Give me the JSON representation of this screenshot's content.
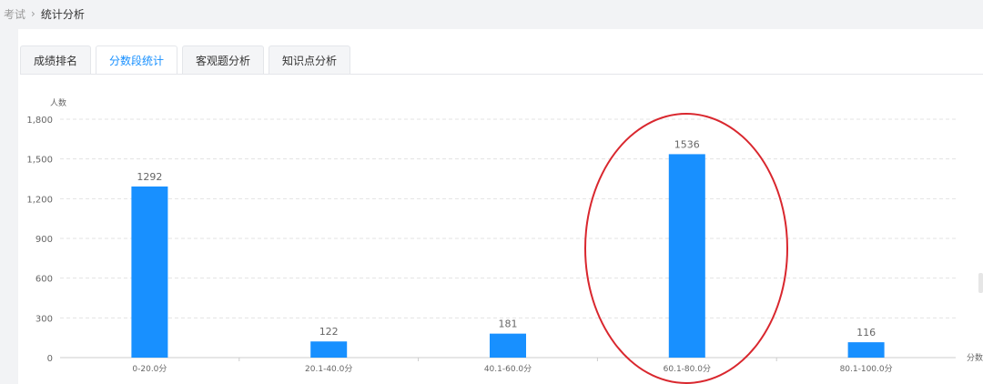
{
  "breadcrumb": {
    "parent": "考试",
    "separator": "›",
    "current": "统计分析"
  },
  "tabs": [
    {
      "label": "成绩排名",
      "active": false
    },
    {
      "label": "分数段统计",
      "active": true
    },
    {
      "label": "客观题分析",
      "active": false
    },
    {
      "label": "知识点分析",
      "active": false
    }
  ],
  "colors": {
    "bar": "#1890ff",
    "active_tab": "#1890ff",
    "circle": "#d9272e"
  },
  "chart_data": {
    "type": "bar",
    "categories": [
      "0-20.0分",
      "20.1-40.0分",
      "40.1-60.0分",
      "60.1-80.0分",
      "80.1-100.0分"
    ],
    "values": [
      1292,
      122,
      181,
      1536,
      116
    ],
    "data_labels": [
      "1292",
      "122",
      "181",
      "1536",
      "116"
    ],
    "ylabel": "人数",
    "xlabel": "分数",
    "ylim": [
      0,
      1800
    ],
    "yticks": [
      0,
      300,
      600,
      900,
      1200,
      1500,
      1800
    ],
    "ytick_labels": [
      "0",
      "300",
      "600",
      "900",
      "1,200",
      "1,500",
      "1,800"
    ],
    "grid": true,
    "highlighted_category": "60.1-80.0分"
  }
}
